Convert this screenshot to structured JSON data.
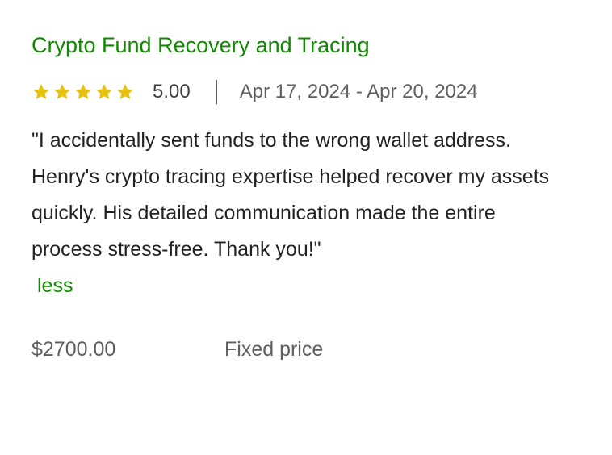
{
  "review": {
    "title": "Crypto Fund Recovery and Tracing",
    "stars": 5,
    "rating_text": "5.00",
    "date_range": "Apr 17, 2024 - Apr 20, 2024",
    "body": "\"I accidentally sent funds to the wrong wallet address. Henry's crypto tracing expertise helped recover my assets quickly. His detailed communication made the entire process stress-free. Thank you!\"",
    "toggle_label": "less",
    "price": "$2700.00",
    "price_type": "Fixed price"
  },
  "colors": {
    "accent_green": "#108a00",
    "star_gold": "#e6c20f",
    "text_dark": "#222222",
    "text_muted": "#5e5e5e"
  },
  "icons": {
    "star": "star-icon"
  }
}
